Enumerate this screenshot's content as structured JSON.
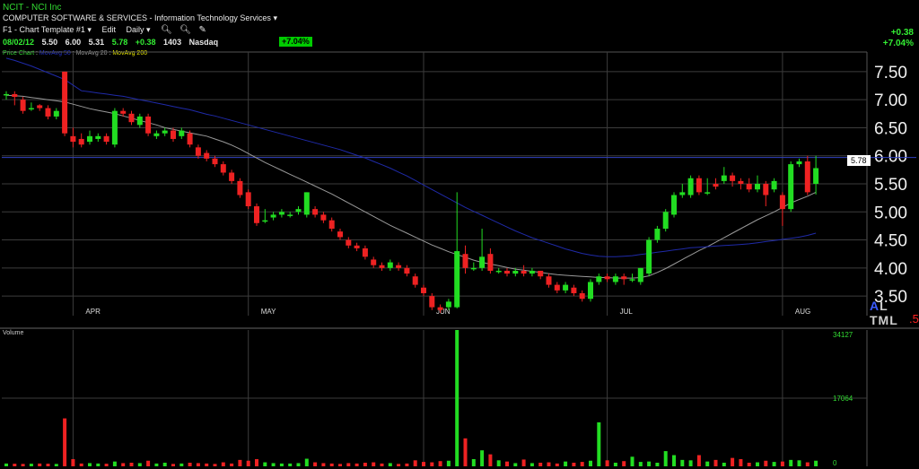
{
  "header": {
    "ticker": "NCIT - NCI Inc",
    "industry": "COMPUTER SOFTWARE & SERVICES - Information Technology Services",
    "template": "F1 - Chart Template #1",
    "edit_label": "Edit",
    "period": "Daily",
    "quote": {
      "date": "08/02/12",
      "open": "5.50",
      "high": "6.00",
      "low": "5.31",
      "close": "5.78",
      "change": "+0.38",
      "volume": "1403",
      "exchange": "Nasdaq"
    },
    "pct_badge": "+7.04%",
    "change_abs": "+0.38",
    "change_pct": "+7.04%"
  },
  "indicators": {
    "price_chart": "Price Chart",
    "ma1": "MovAvg 50",
    "ma2": "MovAvg 20",
    "ma3": "MovAvg 200"
  },
  "last_price_label": "5.78",
  "volume_label": "Volume",
  "side_text": {
    "tri": "A",
    "rest": "L TML"
  },
  "side_dot": ".5",
  "colors": {
    "up": "#22dd22",
    "down": "#ee2222",
    "ma_short": "#999999",
    "ma_long": "#1f2aa8",
    "grid": "#3c3c3c",
    "resistance": "#3040c0"
  },
  "chart_data": [
    {
      "type": "candlestick",
      "ylim": [
        3.15,
        7.85
      ],
      "y_ticks": [
        "7.50",
        "7.00",
        "6.50",
        "6.00",
        "5.50",
        "5.00",
        "4.50",
        "4.00",
        "3.50"
      ],
      "x_labels": [
        {
          "label": "APR",
          "i": 8
        },
        {
          "label": "MAY",
          "i": 29
        },
        {
          "label": "JUN",
          "i": 50
        },
        {
          "label": "JUL",
          "i": 72
        },
        {
          "label": "AUG",
          "i": 93
        }
      ],
      "resistance_level": 5.97,
      "ohlc": [
        [
          7.1,
          7.1,
          7.0,
          7.15
        ],
        [
          7.1,
          7.05,
          6.9,
          7.15
        ],
        [
          7.0,
          6.8,
          6.75,
          7.05
        ],
        [
          6.85,
          6.85,
          6.8,
          6.95
        ],
        [
          6.9,
          6.85,
          6.8,
          6.92
        ],
        [
          6.85,
          6.7,
          6.65,
          6.9
        ],
        [
          6.7,
          6.8,
          6.65,
          6.85
        ],
        [
          7.5,
          6.4,
          6.35,
          7.5
        ],
        [
          6.35,
          6.25,
          6.15,
          6.5
        ],
        [
          6.3,
          6.2,
          6.15,
          6.4
        ],
        [
          6.25,
          6.35,
          6.2,
          6.45
        ],
        [
          6.3,
          6.35,
          6.25,
          6.4
        ],
        [
          6.35,
          6.25,
          6.2,
          6.4
        ],
        [
          6.2,
          6.8,
          6.15,
          6.85
        ],
        [
          6.8,
          6.75,
          6.7,
          6.85
        ],
        [
          6.75,
          6.6,
          6.55,
          6.8
        ],
        [
          6.55,
          6.7,
          6.5,
          6.75
        ],
        [
          6.7,
          6.4,
          6.35,
          6.75
        ],
        [
          6.35,
          6.4,
          6.3,
          6.45
        ],
        [
          6.4,
          6.45,
          6.35,
          6.5
        ],
        [
          6.45,
          6.3,
          6.25,
          6.5
        ],
        [
          6.35,
          6.45,
          6.3,
          6.5
        ],
        [
          6.4,
          6.2,
          6.15,
          6.45
        ],
        [
          6.15,
          6.0,
          5.95,
          6.2
        ],
        [
          6.05,
          5.95,
          5.9,
          6.1
        ],
        [
          5.95,
          5.85,
          5.8,
          6.0
        ],
        [
          5.85,
          5.7,
          5.65,
          5.9
        ],
        [
          5.7,
          5.55,
          5.5,
          5.75
        ],
        [
          5.55,
          5.3,
          5.25,
          5.6
        ],
        [
          5.35,
          5.1,
          5.05,
          5.4
        ],
        [
          5.1,
          4.8,
          4.75,
          5.15
        ],
        [
          4.85,
          4.85,
          4.8,
          5.05
        ],
        [
          4.9,
          4.95,
          4.85,
          5.0
        ],
        [
          4.95,
          5.0,
          4.9,
          5.05
        ],
        [
          4.95,
          4.95,
          4.9,
          5.0
        ],
        [
          5.0,
          5.05,
          4.95,
          5.1
        ],
        [
          4.95,
          5.35,
          4.9,
          5.35
        ],
        [
          5.05,
          4.95,
          4.9,
          5.1
        ],
        [
          4.95,
          4.85,
          4.8,
          5.0
        ],
        [
          4.85,
          4.7,
          4.65,
          4.9
        ],
        [
          4.65,
          4.55,
          4.5,
          4.7
        ],
        [
          4.5,
          4.4,
          4.35,
          4.55
        ],
        [
          4.4,
          4.35,
          4.3,
          4.45
        ],
        [
          4.35,
          4.2,
          4.15,
          4.4
        ],
        [
          4.15,
          4.05,
          4.0,
          4.2
        ],
        [
          4.05,
          4.0,
          3.95,
          4.1
        ],
        [
          4.0,
          4.1,
          3.95,
          4.15
        ],
        [
          4.05,
          4.0,
          3.95,
          4.1
        ],
        [
          4.0,
          3.9,
          3.85,
          4.05
        ],
        [
          3.85,
          3.7,
          3.65,
          3.9
        ],
        [
          3.65,
          3.55,
          3.5,
          3.7
        ],
        [
          3.5,
          3.3,
          3.25,
          3.55
        ],
        [
          3.3,
          3.25,
          3.2,
          3.35
        ],
        [
          3.3,
          3.4,
          3.25,
          3.45
        ],
        [
          3.3,
          4.3,
          3.28,
          5.35
        ],
        [
          4.25,
          4.0,
          3.9,
          4.4
        ],
        [
          4.0,
          4.0,
          3.95,
          4.1
        ],
        [
          4.0,
          4.2,
          3.95,
          4.7
        ],
        [
          4.25,
          3.95,
          3.9,
          4.35
        ],
        [
          3.95,
          3.95,
          3.9,
          4.0
        ],
        [
          3.95,
          3.9,
          3.85,
          4.0
        ],
        [
          3.9,
          3.95,
          3.85,
          4.0
        ],
        [
          3.95,
          3.9,
          3.85,
          4.05
        ],
        [
          3.9,
          3.95,
          3.85,
          4.0
        ],
        [
          3.95,
          3.85,
          3.8,
          3.95
        ],
        [
          3.85,
          3.7,
          3.65,
          3.9
        ],
        [
          3.7,
          3.6,
          3.55,
          3.75
        ],
        [
          3.6,
          3.7,
          3.55,
          3.75
        ],
        [
          3.65,
          3.55,
          3.5,
          3.7
        ],
        [
          3.55,
          3.45,
          3.4,
          3.6
        ],
        [
          3.45,
          3.75,
          3.4,
          3.8
        ],
        [
          3.75,
          3.85,
          3.7,
          3.9
        ],
        [
          3.85,
          3.8,
          3.75,
          3.9
        ],
        [
          3.75,
          3.85,
          3.7,
          3.9
        ],
        [
          3.85,
          3.8,
          3.7,
          3.9
        ],
        [
          3.8,
          3.8,
          3.75,
          3.9
        ],
        [
          3.75,
          4.0,
          3.7,
          4.0
        ],
        [
          3.9,
          4.5,
          3.85,
          4.55
        ],
        [
          4.5,
          4.7,
          4.45,
          4.75
        ],
        [
          4.7,
          5.0,
          4.65,
          5.05
        ],
        [
          4.95,
          5.3,
          4.9,
          5.35
        ],
        [
          5.3,
          5.35,
          5.25,
          5.5
        ],
        [
          5.3,
          5.6,
          5.25,
          5.65
        ],
        [
          5.6,
          5.35,
          5.3,
          5.65
        ],
        [
          5.35,
          5.35,
          5.3,
          5.6
        ],
        [
          5.5,
          5.45,
          5.4,
          5.6
        ],
        [
          5.55,
          5.65,
          5.5,
          5.8
        ],
        [
          5.65,
          5.55,
          5.45,
          5.7
        ],
        [
          5.55,
          5.5,
          5.4,
          5.6
        ],
        [
          5.5,
          5.4,
          5.35,
          5.6
        ],
        [
          5.4,
          5.5,
          5.35,
          5.65
        ],
        [
          5.5,
          5.3,
          5.1,
          5.55
        ],
        [
          5.4,
          5.55,
          5.35,
          5.6
        ],
        [
          5.3,
          5.05,
          4.75,
          5.35
        ],
        [
          5.05,
          5.85,
          5.0,
          5.9
        ],
        [
          5.85,
          5.9,
          5.8,
          5.95
        ],
        [
          5.9,
          5.35,
          5.3,
          6.0
        ],
        [
          5.5,
          5.78,
          5.31,
          6.0
        ]
      ]
    },
    {
      "type": "line",
      "series": [
        {
          "name": "MovAvg 20",
          "y": [
            7.08,
            7.07,
            7.06,
            7.04,
            7.02,
            7.0,
            6.98,
            6.96,
            6.92,
            6.88,
            6.84,
            6.81,
            6.78,
            6.75,
            6.71,
            6.67,
            6.63,
            6.59,
            6.55,
            6.5,
            6.47,
            6.44,
            6.41,
            6.38,
            6.35,
            6.3,
            6.25,
            6.19,
            6.12,
            6.04,
            5.96,
            5.88,
            5.81,
            5.74,
            5.67,
            5.6,
            5.53,
            5.46,
            5.39,
            5.32,
            5.24,
            5.16,
            5.08,
            5.0,
            4.92,
            4.84,
            4.76,
            4.69,
            4.62,
            4.55,
            4.48,
            4.41,
            4.35,
            4.29,
            4.24,
            4.19,
            4.14,
            4.1,
            4.07,
            4.04,
            4.01,
            3.98,
            3.96,
            3.94,
            3.92,
            3.9,
            3.88,
            3.87,
            3.86,
            3.85,
            3.84,
            3.83,
            3.83,
            3.82,
            3.82,
            3.82,
            3.83,
            3.86,
            3.92,
            3.99,
            4.07,
            4.15,
            4.23,
            4.31,
            4.38,
            4.46,
            4.54,
            4.62,
            4.7,
            4.78,
            4.86,
            4.93,
            5.0,
            5.08,
            5.16,
            5.22,
            5.28,
            5.35
          ]
        },
        {
          "name": "MovAvg 50",
          "y": [
            7.74,
            7.7,
            7.65,
            7.6,
            7.54,
            7.48,
            7.42,
            7.36,
            7.26,
            7.16,
            7.14,
            7.12,
            7.1,
            7.08,
            7.06,
            7.03,
            7.0,
            6.97,
            6.94,
            6.91,
            6.88,
            6.85,
            6.82,
            6.78,
            6.74,
            6.71,
            6.67,
            6.63,
            6.59,
            6.55,
            6.51,
            6.47,
            6.43,
            6.39,
            6.35,
            6.31,
            6.27,
            6.23,
            6.19,
            6.15,
            6.11,
            6.06,
            6.01,
            5.96,
            5.9,
            5.84,
            5.78,
            5.71,
            5.64,
            5.56,
            5.48,
            5.4,
            5.32,
            5.24,
            5.16,
            5.08,
            5.01,
            4.94,
            4.87,
            4.8,
            4.73,
            4.66,
            4.6,
            4.54,
            4.49,
            4.44,
            4.39,
            4.34,
            4.3,
            4.26,
            4.23,
            4.21,
            4.2,
            4.2,
            4.21,
            4.22,
            4.24,
            4.26,
            4.28,
            4.3,
            4.32,
            4.34,
            4.36,
            4.37,
            4.38,
            4.39,
            4.4,
            4.41,
            4.42,
            4.43,
            4.45,
            4.47,
            4.49,
            4.51,
            4.53,
            4.55,
            4.58,
            4.62
          ]
        }
      ]
    },
    {
      "type": "bar",
      "name": "Volume",
      "ylim": [
        0,
        34127
      ],
      "y_ticks": [
        "34127",
        "17064",
        "0"
      ],
      "values": [
        700,
        650,
        600,
        650,
        700,
        650,
        600,
        12000,
        1800,
        700,
        800,
        700,
        650,
        1200,
        800,
        900,
        800,
        1400,
        700,
        900,
        600,
        700,
        900,
        800,
        700,
        600,
        1000,
        700,
        1600,
        1400,
        1800,
        1000,
        800,
        700,
        700,
        800,
        1900,
        1000,
        800,
        700,
        600,
        800,
        700,
        900,
        1000,
        700,
        800,
        600,
        700,
        1500,
        1100,
        1000,
        1300,
        1400,
        34127,
        7000,
        1800,
        4000,
        3000,
        1500,
        1200,
        800,
        1700,
        800,
        900,
        1000,
        700,
        1200,
        900,
        1100,
        1400,
        11000,
        1500,
        900,
        1300,
        2400,
        1100,
        1200,
        900,
        3800,
        2800,
        1600,
        1500,
        2800,
        1200,
        1600,
        900,
        2100,
        1800,
        900,
        1000,
        1400,
        1100,
        1200,
        1600,
        1500,
        1000,
        1403
      ]
    }
  ]
}
